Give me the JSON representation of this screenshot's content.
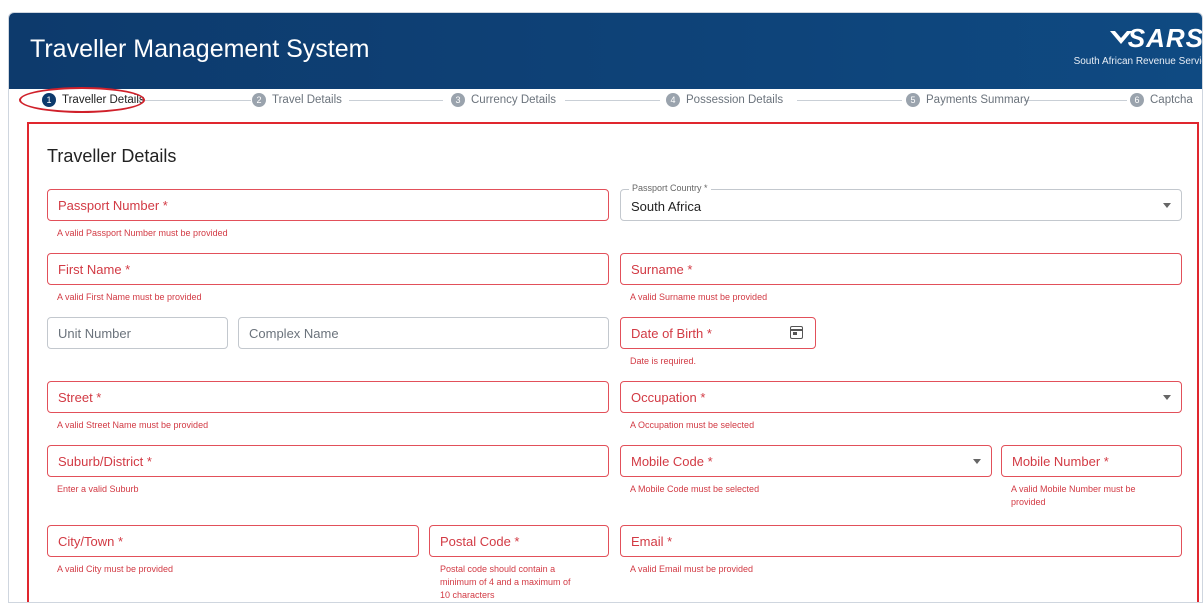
{
  "app": {
    "title": "Traveller Management System",
    "logo_text": "SARS",
    "logo_subtitle": "South African Revenue Service"
  },
  "steps": [
    {
      "num": "1",
      "label": "Traveller Details",
      "active": true
    },
    {
      "num": "2",
      "label": "Travel Details"
    },
    {
      "num": "3",
      "label": "Currency Details"
    },
    {
      "num": "4",
      "label": "Possession Details"
    },
    {
      "num": "5",
      "label": "Payments Summary"
    },
    {
      "num": "6",
      "label": "Captcha"
    }
  ],
  "form": {
    "title": "Traveller Details",
    "passport_number": {
      "placeholder": "Passport Number *",
      "error": "A valid Passport Number must be provided"
    },
    "passport_country": {
      "legend": "Passport Country *",
      "value": "South Africa"
    },
    "first_name": {
      "placeholder": "First Name *",
      "error": "A valid First Name must be provided"
    },
    "surname": {
      "placeholder": "Surname *",
      "error": "A valid Surname must be provided"
    },
    "unit_number": {
      "placeholder": "Unit Number"
    },
    "complex_name": {
      "placeholder": "Complex Name"
    },
    "date_of_birth": {
      "placeholder": "Date of Birth *",
      "error": "Date is required."
    },
    "street": {
      "placeholder": "Street *",
      "error": "A valid Street Name must be provided"
    },
    "occupation": {
      "placeholder": "Occupation *",
      "error": "A Occupation must be selected"
    },
    "suburb": {
      "placeholder": "Suburb/District *",
      "error": "Enter a valid Suburb"
    },
    "mobile_code": {
      "placeholder": "Mobile Code *",
      "error": "A Mobile Code must be selected"
    },
    "mobile_number": {
      "placeholder": "Mobile Number *",
      "error_line1": "A valid Mobile Number must be",
      "error_line2": "provided"
    },
    "city": {
      "placeholder": "City/Town *",
      "error": "A valid City must be provided"
    },
    "postal_code": {
      "placeholder": "Postal Code *",
      "error_line1": "Postal code should contain a",
      "error_line2": "minimum of 4 and a maximum of",
      "error_line3": "10 characters"
    },
    "email": {
      "placeholder": "Email *",
      "error": "A valid Email must be provided"
    }
  },
  "colors": {
    "header": "#0d3a6c",
    "error": "#d23a44",
    "highlight": "#e0262e"
  }
}
